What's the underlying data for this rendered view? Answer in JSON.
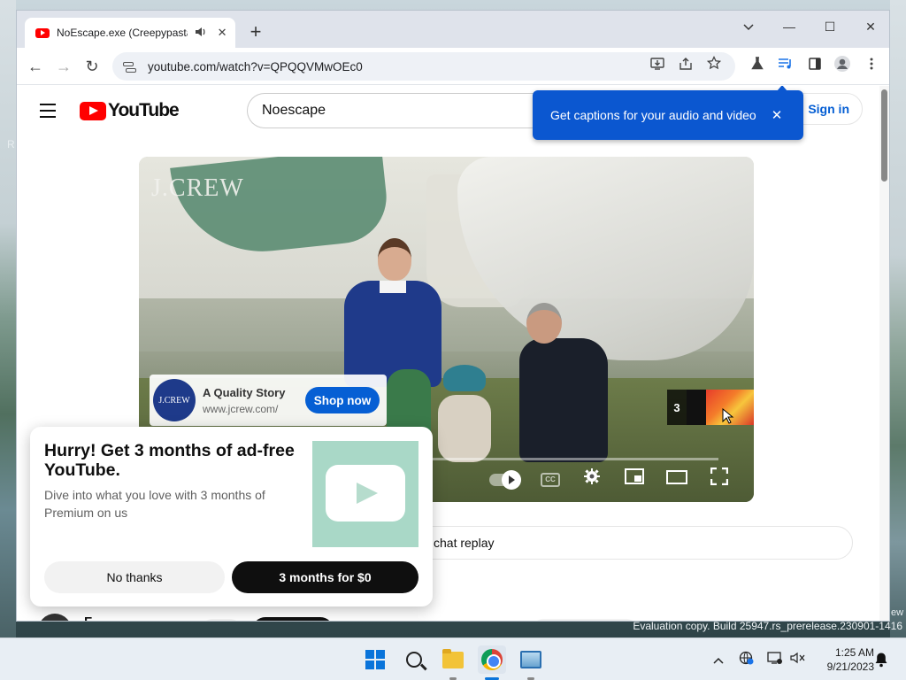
{
  "desktop": {
    "left_edge_text": "R",
    "right_edge_text": "ew",
    "watermark": "Evaluation copy. Build 25947.rs_prerelease.230901-1416"
  },
  "browser": {
    "tab": {
      "title": "NoEscape.exe (Creepypasta",
      "audio_icon": "speaker-icon",
      "close": "✕"
    },
    "new_tab": "+",
    "window_controls": {
      "minimize": "—",
      "maximize": "☐",
      "close": "✕",
      "tab_search": "⌄"
    },
    "nav": {
      "back": "←",
      "forward": "→",
      "reload": "↻"
    },
    "url": "youtube.com/watch?v=QPQQVMwOEc0",
    "omnibox_icons": [
      "install-icon",
      "share-icon",
      "bookmark-star-icon"
    ],
    "toolbar_icons": [
      "labs-flask-icon",
      "media-controls-icon",
      "side-panel-icon",
      "profile-icon",
      "menu-icon"
    ]
  },
  "youtube": {
    "logo_text": "YouTube",
    "search_value": "Noescape",
    "sign_in": "Sign in",
    "captions_bubble": {
      "text": "Get captions for your audio and video",
      "close": "✕"
    },
    "player": {
      "watermark": "J.CREW",
      "ad": {
        "logo_text": "J.CREW",
        "title": "A Quality Story",
        "url": "www.jcrew.com/",
        "cta": "Shop now"
      },
      "skip_countdown": "3",
      "progress_fraction": 0.26,
      "controls": [
        "autoplay-toggle",
        "captions-button",
        "settings-icon",
        "miniplayer-icon",
        "theater-mode-icon",
        "fullscreen-icon"
      ]
    },
    "chat_replay": "chat replay",
    "below_video": {
      "channel_name": "F"
    }
  },
  "premium_popup": {
    "title": "Hurry! Get 3 months of ad-free YouTube.",
    "subtitle": "Dive into what you love with 3 months of Premium on us",
    "dismiss": "No thanks",
    "accept": "3 months for $0"
  },
  "taskbar": {
    "apps": [
      "start-icon",
      "search-icon",
      "file-explorer-icon",
      "chrome-icon",
      "photos-icon"
    ],
    "tray": [
      "chevron-up-icon",
      "network-icon",
      "display-icon",
      "volume-muted-icon"
    ],
    "time": "1:25 AM",
    "date": "9/21/2023"
  },
  "colors": {
    "youtube_red": "#ff0000",
    "bubble_blue": "#0b57d0",
    "link_blue": "#065fd4",
    "ad_button_blue": "#065fd4",
    "dark_button": "#0f0f0f"
  }
}
